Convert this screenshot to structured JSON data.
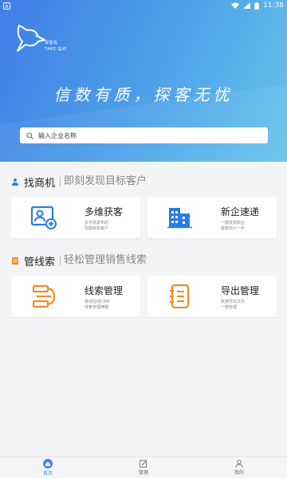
{
  "status_bar": {
    "time": "11:38"
  },
  "brand": {
    "name_cn": "探客岛",
    "name_en": "TAKE 岛屿"
  },
  "hero": {
    "slogan": "信数有质，探客无忧"
  },
  "search": {
    "placeholder": "输入企业名称"
  },
  "sections": [
    {
      "title": "找商机",
      "subtitle": "即刻发现目标客户"
    },
    {
      "title": "管线索",
      "subtitle": "轻松管理销售线索"
    }
  ],
  "cards": [
    {
      "title": "多维获客",
      "desc_line1": "多市场发布的",
      "desc_line2": "挖掘目标客户",
      "icon": "person-card-icon"
    },
    {
      "title": "新企速递",
      "desc_line1": "一键发现新企",
      "desc_line2": "获客快人一步",
      "icon": "buildings-icon"
    },
    {
      "title": "线索管理",
      "desc_line1": "移动在线CRM",
      "desc_line2": "线索管理神器",
      "icon": "pipeline-icon"
    },
    {
      "title": "导出管理",
      "desc_line1": "数量导出文件",
      "desc_line2": "一键管理",
      "icon": "notebook-icon"
    }
  ],
  "tabs": [
    {
      "label": "首页",
      "active": true
    },
    {
      "label": "管理",
      "active": false
    },
    {
      "label": "我的",
      "active": false
    }
  ],
  "colors": {
    "accent": "#3d86f0",
    "icon_blue": "#2a7de1",
    "icon_orange": "#f08a24"
  }
}
